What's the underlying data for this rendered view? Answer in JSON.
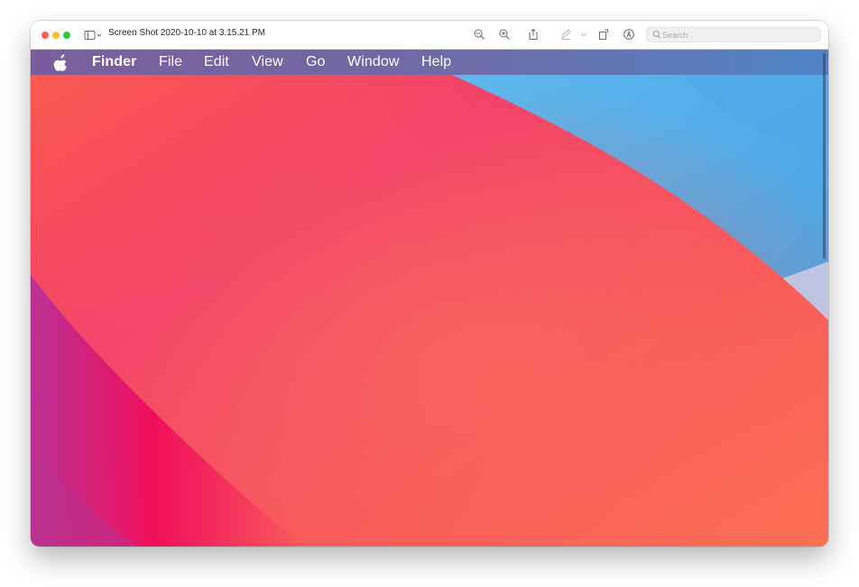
{
  "window": {
    "title": "Screen Shot 2020-10-10 at 3.15.21 PM",
    "traffic_lights": {
      "close_color": "#ff5f57",
      "minimize_color": "#febc2e",
      "zoom_color": "#28c840"
    }
  },
  "toolbar": {
    "icons": [
      "sidebar-toggle-icon",
      "zoom-out-icon",
      "zoom-in-icon",
      "share-icon",
      "markup-pen-icon",
      "rotate-icon",
      "annotate-icon"
    ],
    "search": {
      "placeholder": "Search",
      "value": ""
    }
  },
  "screenshot": {
    "menubar": {
      "apple_icon": "apple-icon",
      "items": [
        {
          "label": "Finder"
        },
        {
          "label": "File"
        },
        {
          "label": "Edit"
        },
        {
          "label": "View"
        },
        {
          "label": "Go"
        },
        {
          "label": "Window"
        },
        {
          "label": "Help"
        }
      ]
    },
    "wallpaper": {
      "colors": {
        "red": "#f43e5d",
        "coral": "#fb6a55",
        "magenta": "#f0075a",
        "blue": "#56b0ea",
        "light_blue": "#a9c8ef"
      }
    }
  }
}
